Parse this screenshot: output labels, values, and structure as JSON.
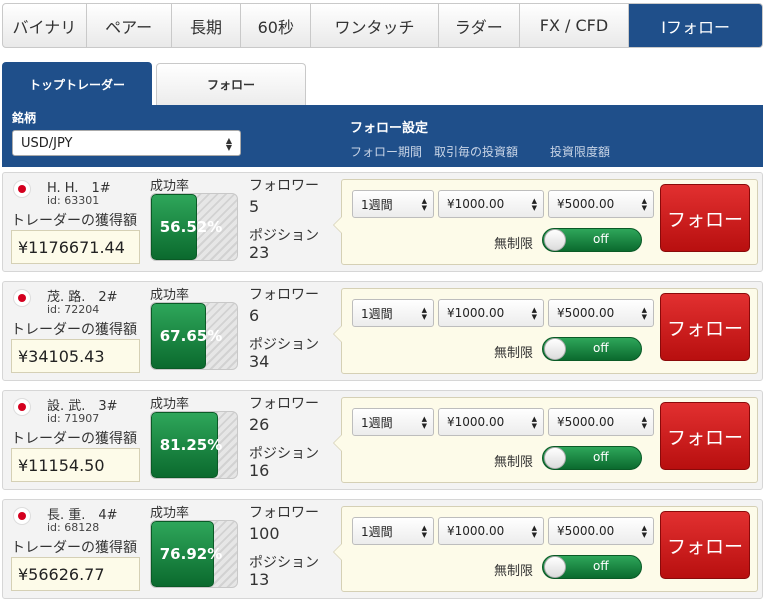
{
  "nav": {
    "tabs": [
      {
        "label": "バイナリ"
      },
      {
        "label": "ペアー"
      },
      {
        "label": "長期"
      },
      {
        "label": "60秒"
      },
      {
        "label": "ワンタッチ"
      },
      {
        "label": "ラダー"
      },
      {
        "label": "FX / CFD"
      },
      {
        "label": "Iフォロー",
        "active": true
      }
    ]
  },
  "subtabs": {
    "top_traders": "トップトレーダー",
    "follow": "フォロー"
  },
  "header": {
    "symbol_label": "銘柄",
    "symbol_value": "USD/JPY",
    "settings_title": "フォロー設定",
    "col_period": "フォロー期間",
    "col_amount": "取引毎の投資額",
    "col_limit": "投資限度額"
  },
  "labels": {
    "earnings": "トレーダーの獲得額",
    "success_rate": "成功率",
    "followers": "フォロワー",
    "positions": "ポジション",
    "unlimited": "無制限",
    "follow_button": "フォロー"
  },
  "colors": {
    "brand": "#1f4f8a",
    "success": "#0b6a2e",
    "follow_button": "#c81818"
  },
  "traders": [
    {
      "name": "H. H.　1#",
      "id": "id: 63301",
      "earnings": "¥1176671.44",
      "success_rate": "56.52%",
      "success_fraction": 0.5652,
      "followers": "5",
      "positions": "23",
      "period": "1週間",
      "amount": "¥1000.00",
      "limit": "¥5000.00",
      "unlimited_state": "off"
    },
    {
      "name": "茂. 路.　2#",
      "id": "id: 72204",
      "earnings": "¥34105.43",
      "success_rate": "67.65%",
      "success_fraction": 0.6765,
      "followers": "6",
      "positions": "34",
      "period": "1週間",
      "amount": "¥1000.00",
      "limit": "¥5000.00",
      "unlimited_state": "off"
    },
    {
      "name": "設. 武.　3#",
      "id": "id: 71907",
      "earnings": "¥11154.50",
      "success_rate": "81.25%",
      "success_fraction": 0.8125,
      "followers": "26",
      "positions": "16",
      "period": "1週間",
      "amount": "¥1000.00",
      "limit": "¥5000.00",
      "unlimited_state": "off"
    },
    {
      "name": "長. 重.　4#",
      "id": "id: 68128",
      "earnings": "¥56626.77",
      "success_rate": "76.92%",
      "success_fraction": 0.7692,
      "followers": "100",
      "positions": "13",
      "period": "1週間",
      "amount": "¥1000.00",
      "limit": "¥5000.00",
      "unlimited_state": "off"
    }
  ]
}
